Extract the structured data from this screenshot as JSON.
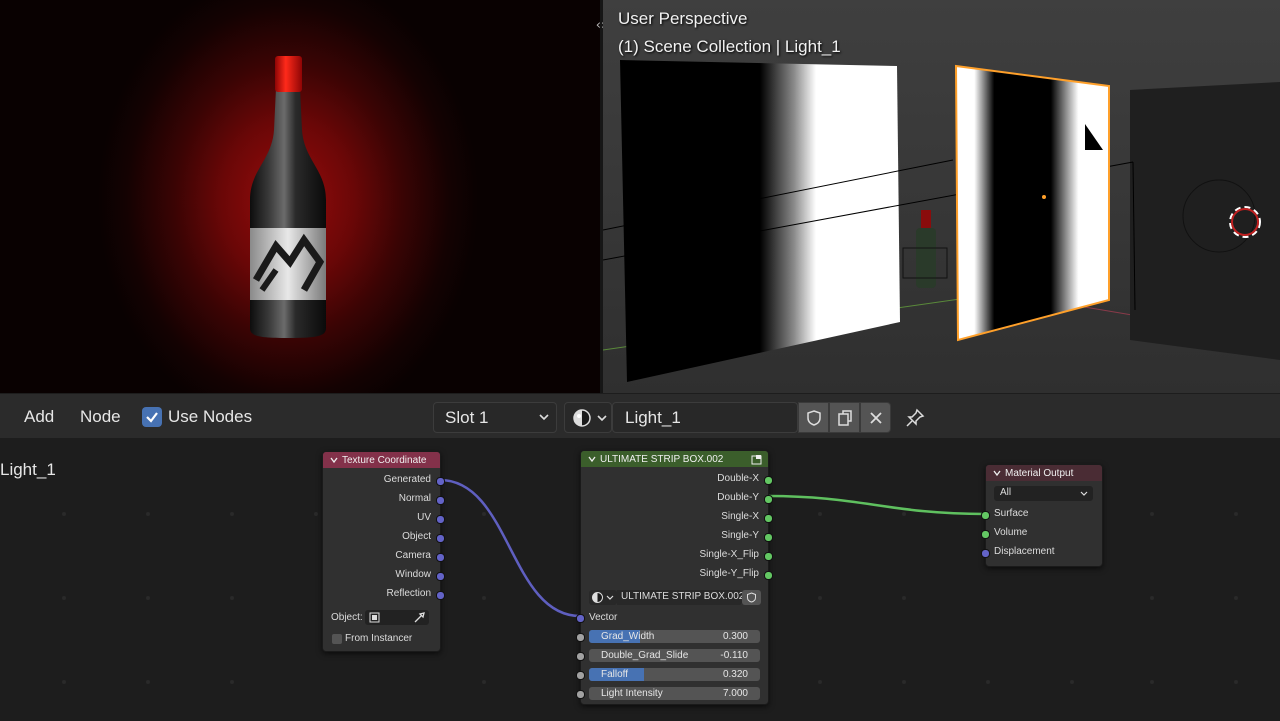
{
  "viewport": {
    "mode": "User Perspective",
    "collection": "(1) Scene Collection | Light_1"
  },
  "header": {
    "menu_add": "Add",
    "menu_node": "Node",
    "use_nodes_label": "Use Nodes",
    "use_nodes_checked": true,
    "slot": "Slot 1",
    "material_name": "Light_1"
  },
  "editor": {
    "material_label": "Light_1"
  },
  "nodes": {
    "texture_coordinate": {
      "title": "Texture Coordinate",
      "outputs": [
        "Generated",
        "Normal",
        "UV",
        "Object",
        "Camera",
        "Window",
        "Reflection"
      ],
      "object_label": "Object:",
      "from_instancer": "From Instancer"
    },
    "strip_box": {
      "title": "ULTIMATE STRIP BOX.002",
      "outputs": [
        "Double-X",
        "Double-Y",
        "Single-X",
        "Single-Y",
        "Single-X_Flip",
        "Single-Y_Flip"
      ],
      "group_name": "ULTIMATE STRIP BOX.002",
      "vector_label": "Vector",
      "inputs": [
        {
          "label": "Grad_Width",
          "value": "0.300",
          "fill": 0.3
        },
        {
          "label": "Double_Grad_Slide",
          "value": "-0.110",
          "fill": 0
        },
        {
          "label": "Falloff",
          "value": "0.320",
          "fill": 0.32
        },
        {
          "label": "Light Intensity",
          "value": "7.000",
          "fill": 0
        }
      ]
    },
    "material_output": {
      "title": "Material Output",
      "target": "All",
      "inputs": [
        "Surface",
        "Volume",
        "Displacement"
      ]
    }
  },
  "colors": {
    "header_tex_coord": "#83314a",
    "header_group": "#3b5e2b",
    "header_output": "#4a2c34",
    "socket_vector": "#6363c7",
    "socket_shader": "#63c763",
    "selection": "#ffa02a"
  }
}
